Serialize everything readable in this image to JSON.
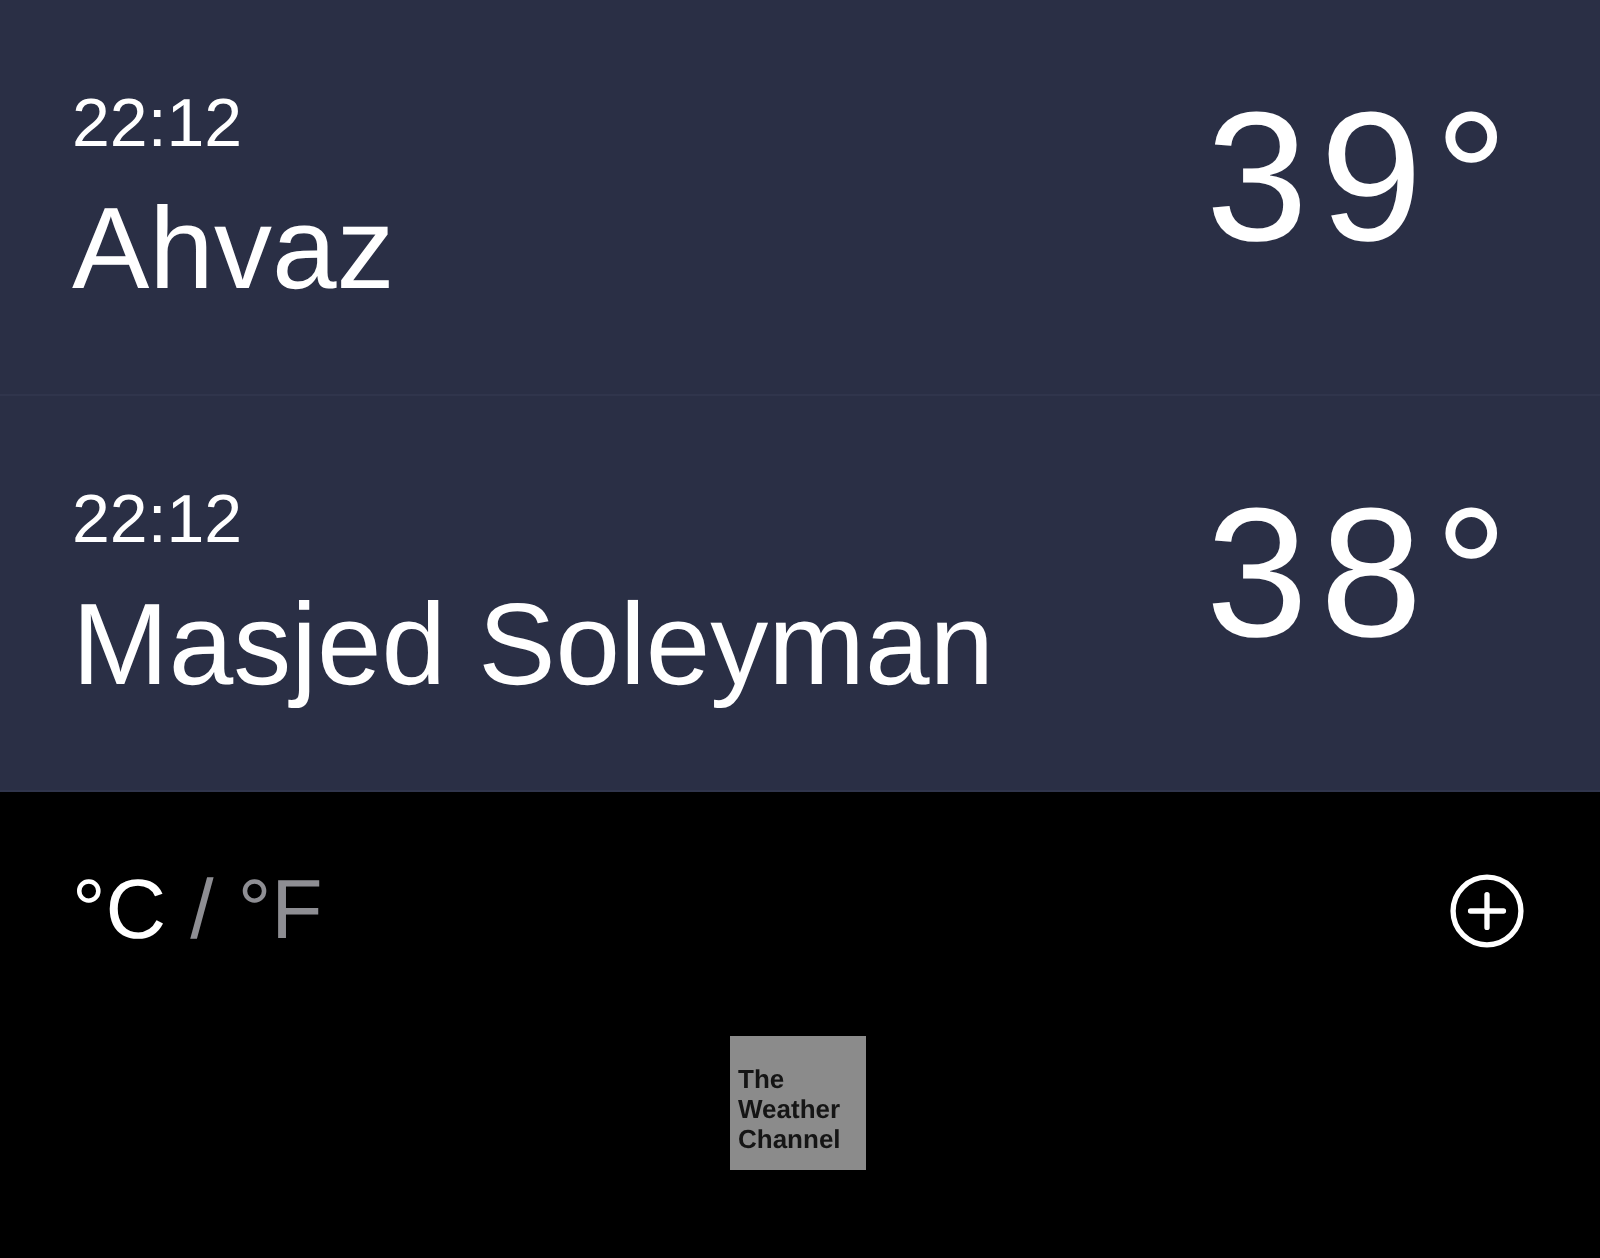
{
  "locations": [
    {
      "time": "22:12",
      "city": "Ahvaz",
      "temperature": "39°"
    },
    {
      "time": "22:12",
      "city": "Masjed Soleyman",
      "temperature": "38°"
    }
  ],
  "footer": {
    "units": [
      {
        "label": "°C",
        "selected": true
      },
      {
        "label": "°F",
        "selected": false
      }
    ],
    "separator": "/"
  },
  "attribution": {
    "logo_text": "The Weather Channel"
  }
}
